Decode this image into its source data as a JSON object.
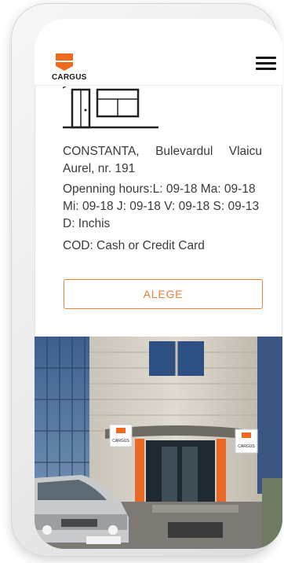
{
  "brand": {
    "name": "CARGUS",
    "accent": "#e8803a",
    "logo_orange": "#f06a1e"
  },
  "header": {
    "menu_icon": "hamburger-menu-icon"
  },
  "location": {
    "address": "CONSTANTA, Bulevardul Vlaicu Aurel, nr. 191",
    "hours": "Openning hours:L: 09-18 Ma: 09-18 Mi: 09-18 J: 09-18 V: 09-18 S: 09-13 D: Inchis",
    "cod": "COD: Cash or Credit Card",
    "select_label": "ALEGE",
    "store_icon": "store-front-icon"
  },
  "photo": {
    "signs": [
      "CARGUS",
      "CARGUS"
    ]
  }
}
